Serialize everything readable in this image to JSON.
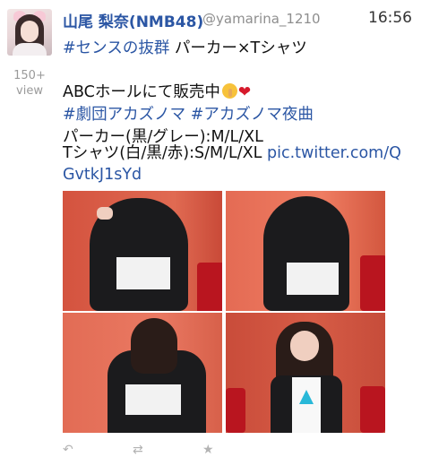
{
  "tweet": {
    "display_name": "山尾 梨奈(NMB48)",
    "handle": "@yamarina_1210",
    "time": "16:56",
    "views_count": "150+",
    "views_label": "view",
    "line1_tag": "#センスの抜群",
    "line1_text": " パーカー×Tシャツ",
    "line2_text": "ABCホールにて販売中",
    "line3_tag1": "#劇団アカズノマ",
    "line3_tag2": "#アカズノマ夜曲",
    "line4_text": "パーカー(黒/グレー):M/L/XL",
    "line5_text": "Tシャツ(白/黒/赤):S/M/L/XL",
    "line5_link": "pic.twitter.com/Q",
    "line6_link": "GvtkJ1sYd"
  },
  "icons": {
    "avatar": "avatar",
    "emoji1": "shushing-face-emoji",
    "emoji2": "red-heart-emoji",
    "photos": [
      "photo-hoodie-back-hood-up",
      "photo-hoodie-back-hood-up-2",
      "photo-hoodie-back-hair-down",
      "photo-tshirt-front"
    ],
    "actions": [
      "reply-icon",
      "retweet-icon",
      "favorite-icon"
    ]
  },
  "colors": {
    "link_blue": "#2b56a4",
    "muted_gray": "#9a9a9a",
    "heart_red": "#d6192b"
  }
}
